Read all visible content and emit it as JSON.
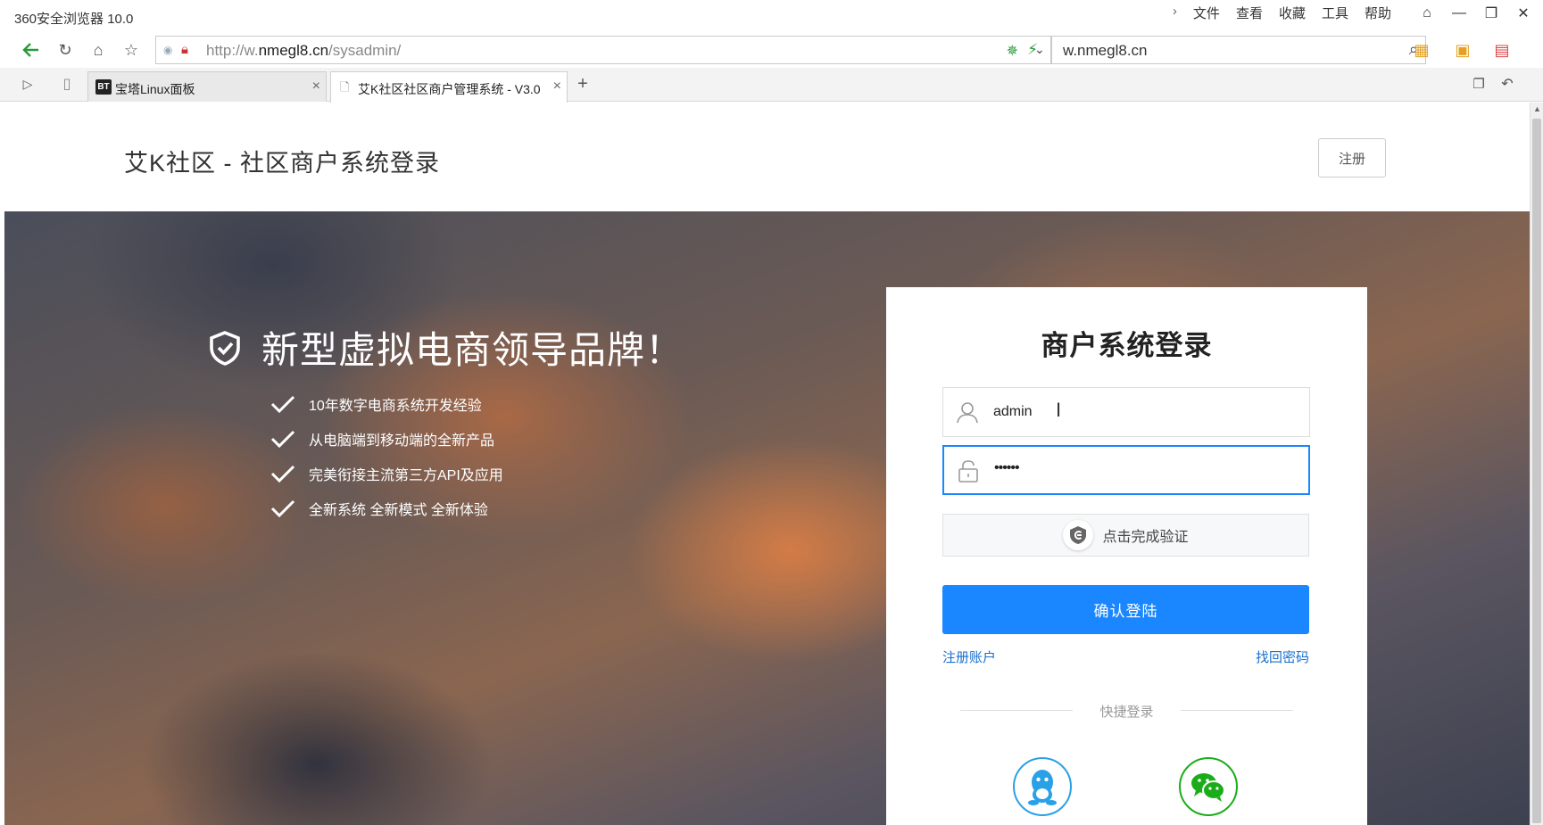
{
  "browser": {
    "app_title": "360安全浏览器 10.0",
    "menu": [
      "文件",
      "查看",
      "收藏",
      "工具",
      "帮助"
    ],
    "url_prefix": "http://w.",
    "url_domain": "nmegl8.cn",
    "url_path": "/sysadmin/",
    "search_text": "w.nmegl8.cn",
    "tabs": [
      {
        "badge": "BT",
        "label": "宝塔Linux面板",
        "close": "×"
      },
      {
        "label": "艾K社区社区商户管理系统 - V3.0",
        "close": "×"
      }
    ],
    "new_tab": "+"
  },
  "header": {
    "site_title": "艾K社区 - 社区商户系统登录",
    "register_label": "注册"
  },
  "hero": {
    "slogan": "新型虚拟电商领导品牌！",
    "features": [
      "10年数字电商系统开发经验",
      "从电脑端到移动端的全新产品",
      "完美衔接主流第三方API及应用",
      "全新系统 全新模式 全新体验"
    ]
  },
  "login": {
    "title": "商户系统登录",
    "username_value": "admin",
    "password_value": "••••••",
    "verify_label": "点击完成验证",
    "submit_label": "确认登陆",
    "register_link": "注册账户",
    "forgot_link": "找回密码",
    "quick_login_label": "快捷登录"
  },
  "colors": {
    "primary": "#1a86ff",
    "link": "#1a6fcf",
    "qq": "#2aa0e6",
    "wechat": "#1aad19"
  }
}
